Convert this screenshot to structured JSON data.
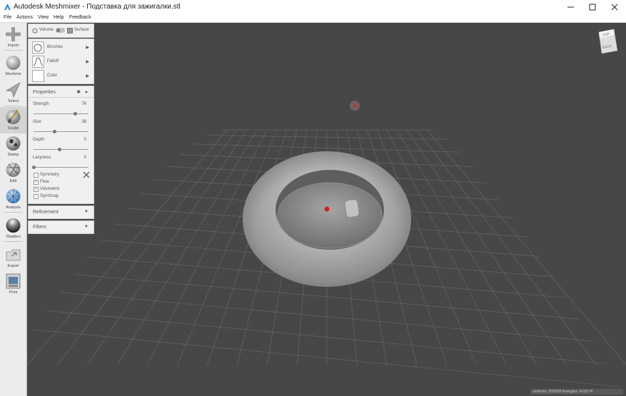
{
  "window": {
    "title": "Autodesk Meshmixer - Подставка для зажигалки.stl"
  },
  "menu": [
    "File",
    "Actions",
    "View",
    "Help",
    "Feedback"
  ],
  "tools": [
    {
      "label": "Import",
      "icon": "plus-icon"
    },
    {
      "label": "Meshmix",
      "icon": "sphere-icon"
    },
    {
      "label": "Select",
      "icon": "arrow-cursor-icon"
    },
    {
      "label": "Sculpt",
      "icon": "brush-icon"
    },
    {
      "label": "Stamp",
      "icon": "stamp-icon"
    },
    {
      "label": "Edit",
      "icon": "edit-sphere-icon"
    },
    {
      "label": "Analysis",
      "icon": "analysis-sphere-icon"
    },
    {
      "label": "Shaders",
      "icon": "shader-sphere-icon"
    },
    {
      "label": "Export",
      "icon": "export-icon"
    },
    {
      "label": "Print",
      "icon": "printer-icon"
    }
  ],
  "mode": {
    "volume_label": "Volume",
    "surface_label": "Surface"
  },
  "brush_panel": {
    "brushes_label": "Brushes",
    "falloff_label": "Falloff",
    "color_label": "Color"
  },
  "properties": {
    "title": "Properties",
    "strength": {
      "label": "Strength",
      "value": "76",
      "fraction": 0.76
    },
    "size": {
      "label": "Size",
      "value": "38",
      "fraction": 0.38
    },
    "depth": {
      "label": "Depth",
      "value": "0",
      "fraction": 0.48
    },
    "lazyness": {
      "label": "Lazyness",
      "value": "0",
      "fraction": 0.0
    },
    "checkboxes": [
      {
        "label": "Symmetry",
        "checked": false
      },
      {
        "label": "Flow",
        "checked": true
      },
      {
        "label": "Volumetric",
        "checked": true
      },
      {
        "label": "SymSnap",
        "checked": false
      }
    ]
  },
  "refinement": {
    "title": "Refinement"
  },
  "filters": {
    "title": "Filters"
  },
  "navcube": {
    "top_label": "TOP",
    "back_label": "BACK"
  },
  "status": {
    "text": "vertices: 205589 triangles: 410174"
  },
  "colors": {
    "viewport_bg": "#474747",
    "panel_bg": "#f0f0f0",
    "brush_marker": "#d02020"
  }
}
